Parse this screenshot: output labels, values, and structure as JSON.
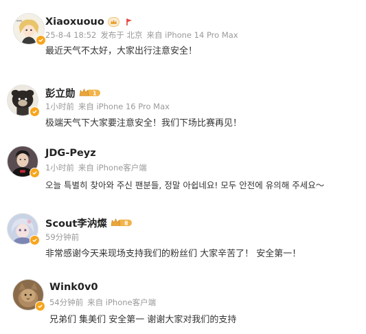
{
  "comments": [
    {
      "name": "Xiaoxuouo",
      "time": "25-8-4 18:52",
      "location": "发布于 北京",
      "device": "来自 iPhone 14 Pro Max",
      "text": "最近天气不太好，大家出行注意安全！",
      "avatar_icon": "cartoon-character-avatar",
      "badge_icon": "crown-badge-icon"
    },
    {
      "name": "彭立勋",
      "time": "1小时前",
      "device": "来自 iPhone 16 Pro Max",
      "text": "极端天气下大家要注意安全！我们下场比赛再见！",
      "avatar_icon": "plush-toy-avatar",
      "badge_icon": "vip-crown-badge-icon",
      "badge_level": "1"
    },
    {
      "name": "JDG-Peyz",
      "time": "1小时前",
      "device": "来自 iPhone客户端",
      "text": "오늘 특별히 찾아와 주신 팬분들, 정말 아쉽네요! 모두 안전에 유의해 주세요～",
      "avatar_icon": "player-photo-avatar"
    },
    {
      "name": "Scout李汭燦",
      "time": "59分钟前",
      "text": "非常感谢今天来现场支持我们的粉丝们 大家辛苦了！ 安全第一！",
      "avatar_icon": "anime-character-avatar",
      "badge_icon": "vip-crown-badge-icon",
      "badge_level": "8"
    },
    {
      "name": "Wink0v0",
      "time": "54分钟前",
      "device": "来自 iPhone客户端",
      "text": "兄弟们 集美们 安全第一 谢谢大家对我们的支持",
      "avatar_icon": "cat-photo-avatar"
    }
  ],
  "colors": {
    "verified": "#f7a51c",
    "name": "#222222",
    "meta": "#999999",
    "text": "#333333",
    "badge_gold": "#e9a43a"
  }
}
